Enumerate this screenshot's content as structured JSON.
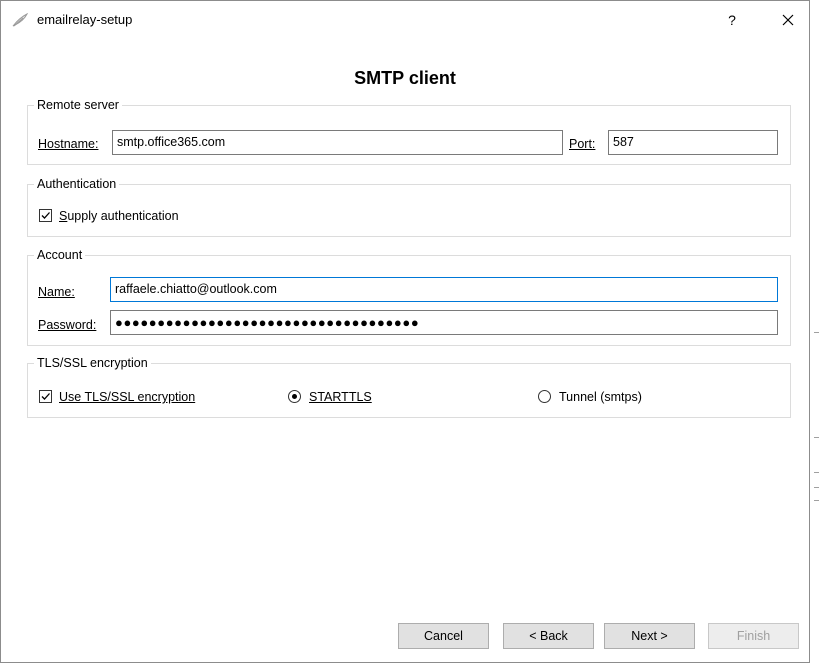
{
  "window": {
    "title": "emailrelay-setup",
    "help_label": "?",
    "close_label": "✕",
    "app_icon": "feather-pen-icon"
  },
  "page_heading": "SMTP client",
  "remote_server": {
    "group_title": "Remote server",
    "hostname_label": "Hostname:",
    "hostname_value": "smtp.office365.com",
    "port_label": "Port:",
    "port_value": "587"
  },
  "authentication": {
    "group_title": "Authentication",
    "supply_label": "Supply authentication",
    "supply_checked": true
  },
  "account": {
    "group_title": "Account",
    "name_label": "Name:",
    "name_value": "raffaele.chiatto@outlook.com",
    "password_label": "Password:",
    "password_mask": "●●●●●●●●●●●●●●●●●●●●●●●●●●●●●●●●●●●●"
  },
  "tls": {
    "group_title": "TLS/SSL encryption",
    "use_label": "Use TLS/SSL encryption",
    "use_checked": true,
    "starttls_label": "STARTTLS",
    "starttls_selected": true,
    "tunnel_label": "Tunnel (smtps)",
    "tunnel_selected": false
  },
  "buttons": {
    "cancel": "Cancel",
    "back": "< Back",
    "next": "Next >",
    "finish": "Finish"
  },
  "colors": {
    "focus_border": "#0078d7",
    "button_face": "#e1e1e1",
    "disabled_text": "#a0a0a0"
  }
}
